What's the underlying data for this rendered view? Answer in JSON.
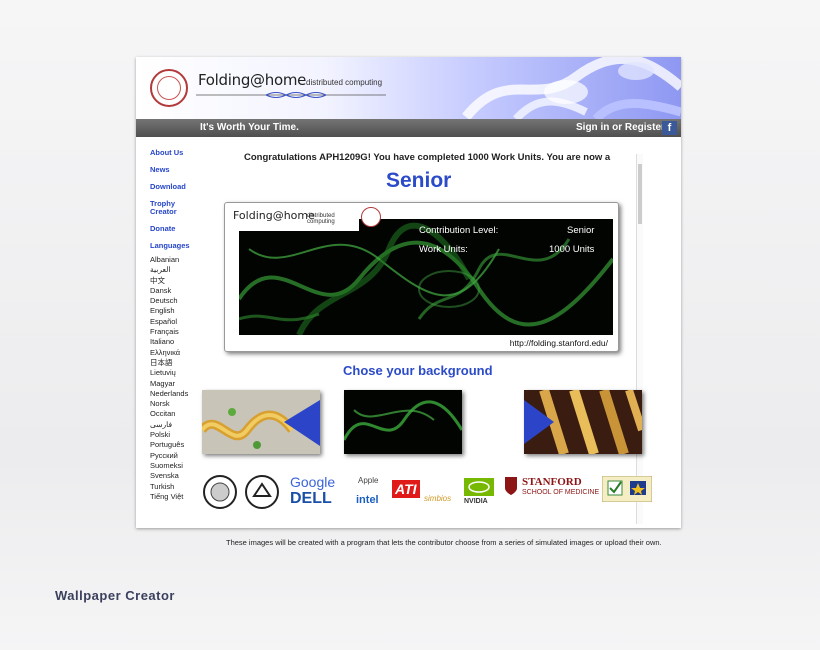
{
  "header": {
    "brand": "Folding@home",
    "brand_sub": "distributed computing",
    "tagline": "It's Worth Your Time.",
    "signin": "Sign in or Register",
    "fb_icon": "f"
  },
  "sidebar": {
    "links": [
      "About Us",
      "News",
      "Download",
      "Trophy Creator",
      "Donate"
    ],
    "languages_heading": "Languages",
    "languages": [
      "Albanian",
      "العربية",
      "中文",
      "Dansk",
      "Deutsch",
      "English",
      "Español",
      "Français",
      "Italiano",
      "Ελληνικά",
      "日本語",
      "Lietuvių",
      "Magyar",
      "Nederlands",
      "Norsk",
      "Occitan",
      "فارسی",
      "Polski",
      "Português",
      "Русский",
      "Suomeksi",
      "Svenska",
      "Turkish",
      "Tiếng Việt"
    ]
  },
  "main": {
    "congrats": "Congratulations APH1209G! You have completed 1000 Work Units. You are now a",
    "level": "Senior",
    "card": {
      "brand": "Folding@home",
      "brand_sub": "distributed computing",
      "contribution_label": "Contribution Level:",
      "contribution_value": "Senior",
      "work_units_label": "Work Units:",
      "work_units_value": "1000 Units",
      "url": "http://folding.stanford.edu/"
    },
    "choose_title": "Chose your background"
  },
  "sponsors": {
    "google": "Google",
    "dell": "DELL",
    "apple": "Apple",
    "intel": "intel",
    "ati": "ATI",
    "simbios": "simbios",
    "nvidia": "NVIDIA",
    "stanford": "STANFORD",
    "stanford_sub": "SCHOOL OF MEDICINE"
  },
  "caption": "These images will be created with a program that lets the contributor choose from a series of simulated images or upload their own.",
  "page_title": "Wallpaper Creator",
  "colors": {
    "link_blue": "#2646c8",
    "headline_blue": "#2b4bc8",
    "toolbar_gray": "#5a5a5a",
    "stanford_red": "#8c1515"
  }
}
